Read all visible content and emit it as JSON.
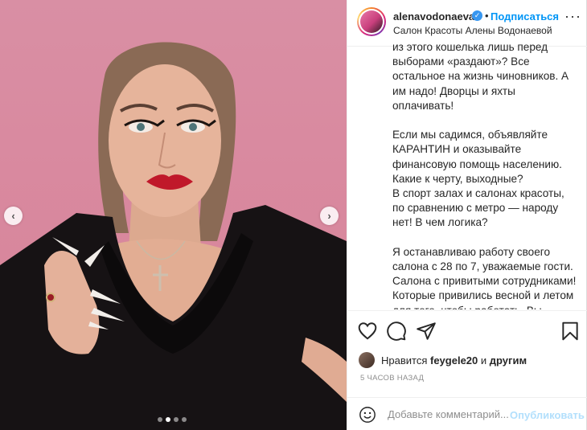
{
  "post": {
    "author": {
      "username": "alenavodonaeva",
      "verified": true,
      "separator": "•",
      "follow_label": "Подписаться",
      "location": "Салон Красоты Алены Водонаевой",
      "more_icon": "more-horizontal-icon"
    },
    "photo": {
      "prev_icon": "chevron-left-icon",
      "next_icon": "chevron-right-icon",
      "prev_glyph": "‹",
      "next_glyph": "›",
      "slides_total": 4,
      "active_slide": 2
    },
    "caption": [
      "из этого кошелька лишь перед выборами «раздают»? Все остальное на жизнь чиновников. А им надо! Дворцы и яхты оплачивать!",
      "Если мы садимся, объявляйте КАРАНТИН и оказывайте финансовую помощь населению. Какие к черту, выходные?\nВ спорт залах и салонах красоты, по сравнению с метро — народу нет! В чем логика?",
      "Я останавливаю работу своего салона с 28 по 7, уважаемые гости.\nСалона с привитыми сотрудниками! Которые привились весной и летом для того, чтобы работать. Вы издеваетесь?"
    ],
    "actions": {
      "like_icon": "heart-icon",
      "comment_icon": "comment-icon",
      "share_icon": "paper-plane-icon",
      "save_icon": "bookmark-icon"
    },
    "likes": {
      "prefix": "Нравится",
      "user": "feygele20",
      "and": "и",
      "others": "другим"
    },
    "timestamp": "5 ЧАСОВ НАЗАД",
    "comment": {
      "emoji_icon": "smiley-icon",
      "placeholder": "Добавьте комментарий...",
      "publish_label": "Опубликовать"
    }
  },
  "colors": {
    "link_blue": "#0095f6",
    "publish_disabled": "#b2dffc",
    "verified_blue": "#3897f0",
    "photo_background": "#d98fa4"
  }
}
